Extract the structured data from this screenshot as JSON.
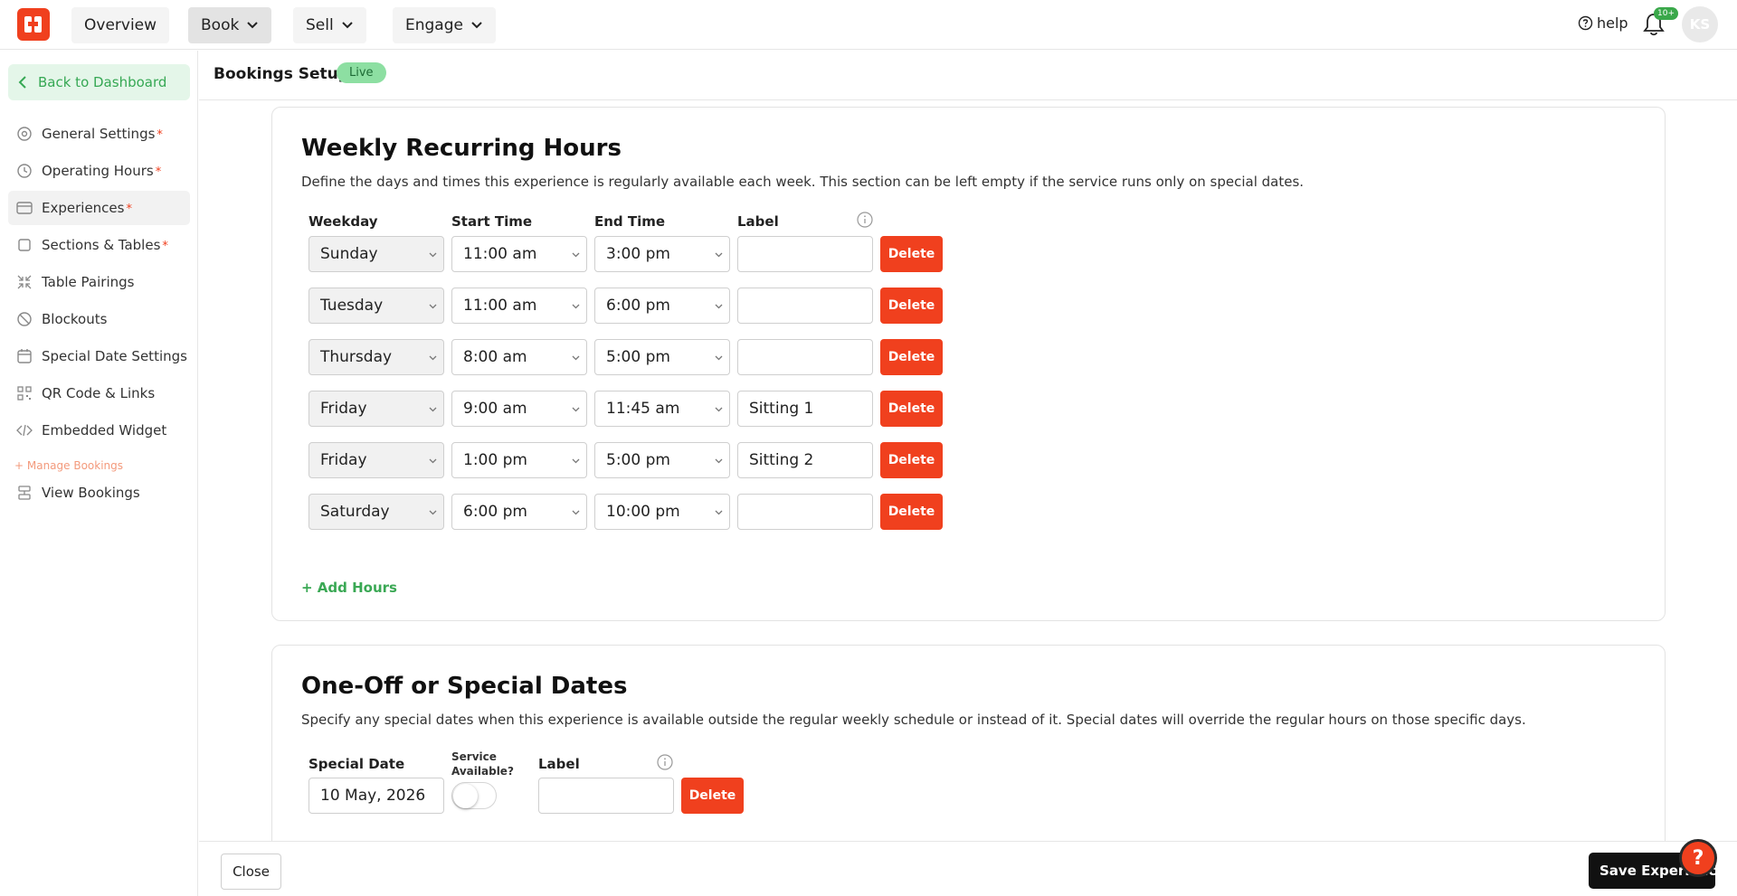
{
  "topnav": {
    "items": [
      {
        "label": "Overview"
      },
      {
        "label": "Book"
      },
      {
        "label": "Sell"
      },
      {
        "label": "Engage"
      }
    ],
    "help_label": "help",
    "notification_badge": "10+",
    "avatar_initials": "KS"
  },
  "sidebar": {
    "back_label": "Back to Dashboard",
    "items": [
      {
        "label": "General Settings",
        "required": "*",
        "icon": "gear-icon"
      },
      {
        "label": "Operating Hours",
        "required": "*",
        "icon": "clock-icon"
      },
      {
        "label": "Experiences",
        "required": "*",
        "icon": "card-icon"
      },
      {
        "label": "Sections & Tables",
        "required": "*",
        "icon": "square-icon"
      },
      {
        "label": "Table Pairings",
        "required": "",
        "icon": "compress-icon"
      },
      {
        "label": "Blockouts",
        "required": "",
        "icon": "ban-icon"
      },
      {
        "label": "Special Date Settings",
        "required": "",
        "icon": "calendar-icon"
      },
      {
        "label": "QR Code & Links",
        "required": "",
        "icon": "qr-icon"
      },
      {
        "label": "Embedded Widget",
        "required": "",
        "icon": "code-icon"
      }
    ],
    "manage_label": "+ Manage Bookings",
    "view_bookings_label": "View Bookings"
  },
  "header": {
    "title": "Bookings Setup",
    "status": "Live"
  },
  "weekly": {
    "title": "Weekly Recurring Hours",
    "description": "Define the days and times this experience is regularly available each week. This section can be left empty if the service runs only on special dates.",
    "col_weekday": "Weekday",
    "col_start": "Start Time",
    "col_end": "End Time",
    "col_label": "Label",
    "delete_label": "Delete",
    "rows": [
      {
        "weekday": "Sunday",
        "start": "11:00 am",
        "end": "3:00 pm",
        "label": ""
      },
      {
        "weekday": "Tuesday",
        "start": "11:00 am",
        "end": "6:00 pm",
        "label": ""
      },
      {
        "weekday": "Thursday",
        "start": "8:00 am",
        "end": "5:00 pm",
        "label": ""
      },
      {
        "weekday": "Friday",
        "start": "9:00 am",
        "end": "11:45 am",
        "label": "Sitting 1"
      },
      {
        "weekday": "Friday",
        "start": "1:00 pm",
        "end": "5:00 pm",
        "label": "Sitting 2"
      },
      {
        "weekday": "Saturday",
        "start": "6:00 pm",
        "end": "10:00 pm",
        "label": ""
      }
    ],
    "add_label": "+ Add Hours"
  },
  "special": {
    "title": "One-Off or Special Dates",
    "description": "Specify any special dates when this experience is available outside the regular weekly schedule or instead of it. Special dates will override the regular hours on those specific days.",
    "col_date": "Special Date",
    "col_service_line1": "Service",
    "col_service_line2": "Available?",
    "col_label": "Label",
    "date_value": "10 May, 2026",
    "service_available": false,
    "label_value": "",
    "delete_label": "Delete"
  },
  "footer": {
    "close_label": "Close",
    "save_label": "Save Experience"
  },
  "help_fab": "?",
  "colors": {
    "brand": "#f0401e",
    "accent_green": "#3aa854",
    "live_badge": "#8ddfa2"
  }
}
